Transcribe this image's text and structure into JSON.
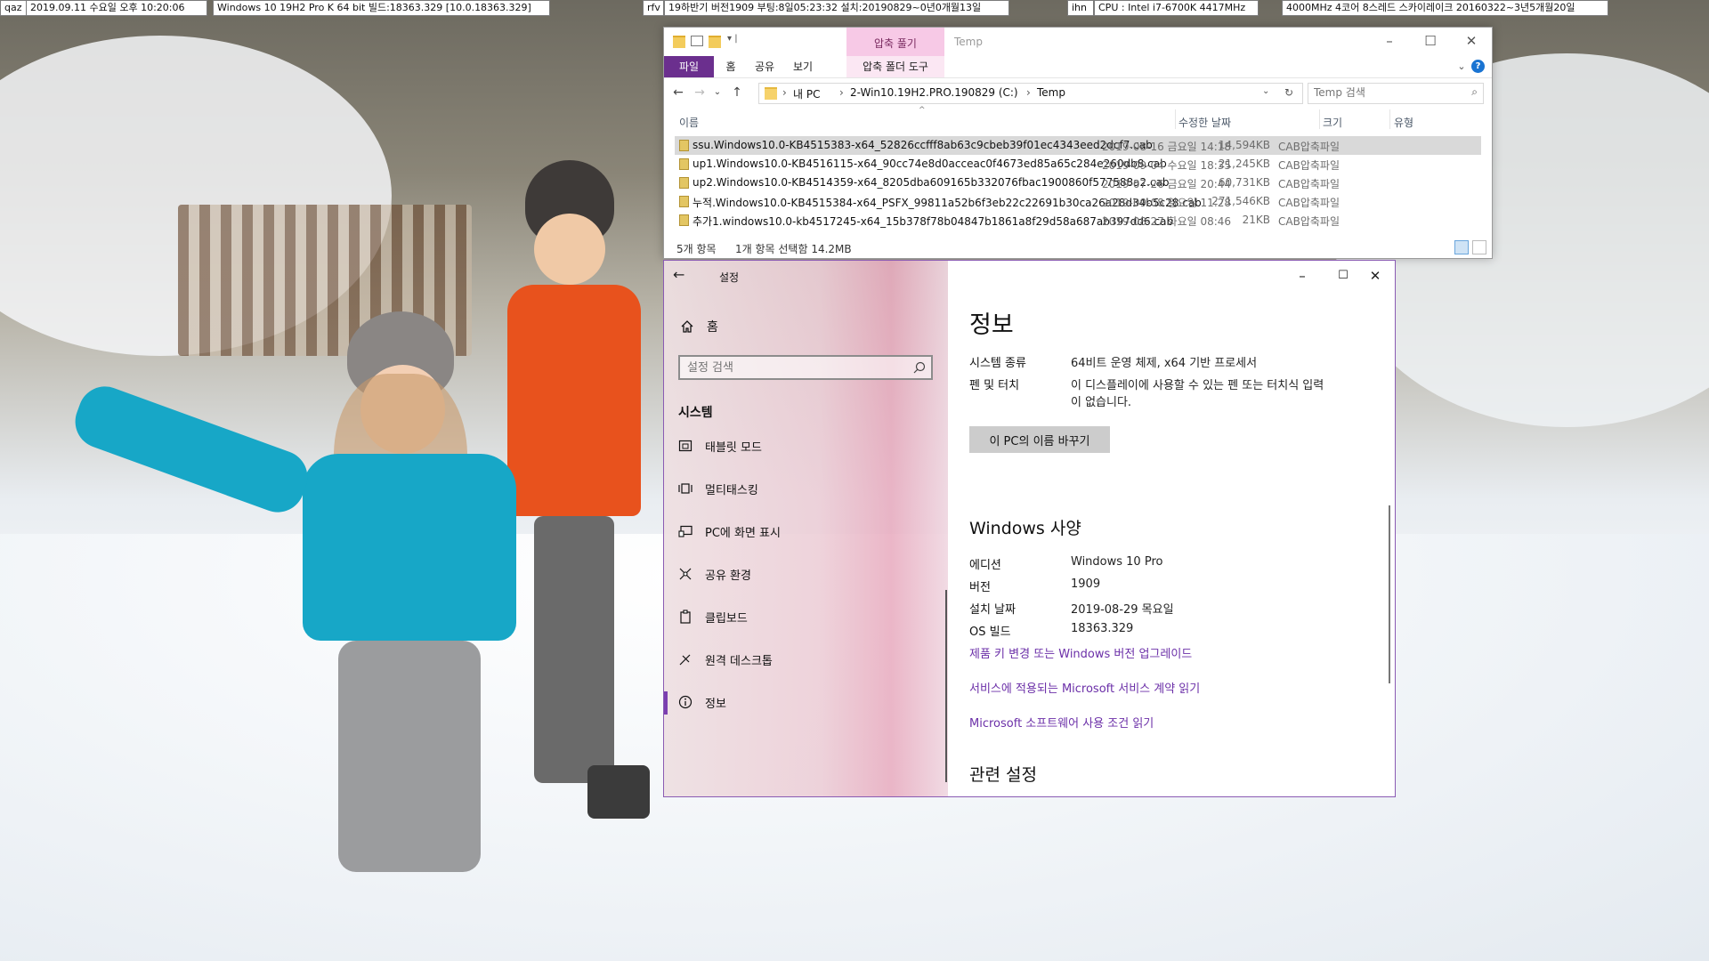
{
  "infobar": {
    "items": [
      "qaz",
      "2019.09.11 수요일 오후 10:20:06",
      "Windows 10 19H2 Pro K 64 bit 빌드:18363.329 [10.0.18363.329]",
      "rfv",
      "19하반기 버전1909 부팅:8일05:23:32 설치:20190829~0년0개월13일",
      "ihn",
      "CPU : Intel i7-6700K 4417MHz",
      "4000MHz 4코어 8스레드 스카이레이크 20160322~3년5개월20일"
    ]
  },
  "explorer": {
    "context_tab_header": "압축 풀기",
    "title": "Temp",
    "ribbon_tabs": [
      "파일",
      "홈",
      "공유",
      "보기",
      "압축 폴더 도구"
    ],
    "address": {
      "crumbs": [
        "내 PC",
        "2-Win10.19H2.PRO.190829 (C:)",
        "Temp"
      ]
    },
    "search_placeholder": "Temp 검색",
    "columns": {
      "name": "이름",
      "date": "수정한 날짜",
      "size": "크기",
      "type": "유형"
    },
    "files": [
      {
        "name": "ssu.Windows10.0-KB4515383-x64_52826ccfff8ab63c9cbeb39f01ec4343eed2dcf7.cab",
        "date": "2019-08-16 금요일 14:18",
        "size": "14,594KB",
        "type": "CAB압축파일",
        "selected": true
      },
      {
        "name": "up1.Windows10.0-KB4516115-x64_90cc74e8d0acceac0f4673ed85a65c284e260db8.cab",
        "date": "2019-09-04 수요일 18:35",
        "size": "21,245KB",
        "type": "CAB압축파일",
        "selected": false
      },
      {
        "name": "up2.Windows10.0-KB4514359-x64_8205dba609165b332076fbac1900860f577588a2.cab",
        "date": "2019-07-26 금요일 20:44",
        "size": "60,731KB",
        "type": "CAB압축파일",
        "selected": false
      },
      {
        "name": "누적.Windows10.0-KB4515384-x64_PSFX_99811a52b6f3eb22c22691b30ca26a28d34b5c28.cab",
        "date": "2019-09-08 일요일 11:28",
        "size": "271,546KB",
        "type": "CAB압축파일",
        "selected": false
      },
      {
        "name": "추가1.windows10.0-kb4517245-x64_15b378f78b04847b1861a8f29d58a687ab397dd6.cab",
        "date": "2019-08-27 화요일 08:46",
        "size": "21KB",
        "type": "CAB압축파일",
        "selected": false
      }
    ],
    "status": {
      "count": "5개 항목",
      "selected": "1개 항목 선택함 14.2MB"
    }
  },
  "settings": {
    "title": "설정",
    "home": "홈",
    "search_placeholder": "설정 검색",
    "section": "시스템",
    "nav": [
      {
        "label": "태블릿 모드",
        "icon": "tablet-mode-icon",
        "active": false
      },
      {
        "label": "멀티태스킹",
        "icon": "multitasking-icon",
        "active": false
      },
      {
        "label": "PC에 화면 표시",
        "icon": "project-to-pc-icon",
        "active": false
      },
      {
        "label": "공유 환경",
        "icon": "shared-experiences-icon",
        "active": false
      },
      {
        "label": "클립보드",
        "icon": "clipboard-icon",
        "active": false
      },
      {
        "label": "원격 데스크톱",
        "icon": "remote-desktop-icon",
        "active": false
      },
      {
        "label": "정보",
        "icon": "info-icon",
        "active": true
      }
    ],
    "page_title": "정보",
    "specs": [
      {
        "key": "시스템 종류",
        "value": "64비트 운영 체제, x64 기반 프로세서"
      },
      {
        "key": "펜 및 터치",
        "value": "이 디스플레이에 사용할 수 있는 펜 또는 터치식 입력",
        "value2": "이 없습니다."
      }
    ],
    "rename_button": "이 PC의 이름 바꾸기",
    "windows_spec_title": "Windows 사양",
    "windows_specs": [
      {
        "key": "에디션",
        "value": "Windows 10 Pro"
      },
      {
        "key": "버전",
        "value": "1909"
      },
      {
        "key": "설치 날짜",
        "value": "2019-08-29 목요일"
      },
      {
        "key": "OS 빌드",
        "value": "18363.329"
      }
    ],
    "links": [
      "제품 키 변경 또는 Windows 버전 업그레이드",
      "서비스에 적용되는 Microsoft 서비스 계약 읽기",
      "Microsoft 소프트웨어 사용 조건 읽기"
    ],
    "related_title": "관련 설정"
  },
  "colors": {
    "accent": "#7b3fb0",
    "link": "#6b2fa8",
    "file_tab": "#6b2f8e",
    "context_tab": "#f7c9e6"
  }
}
